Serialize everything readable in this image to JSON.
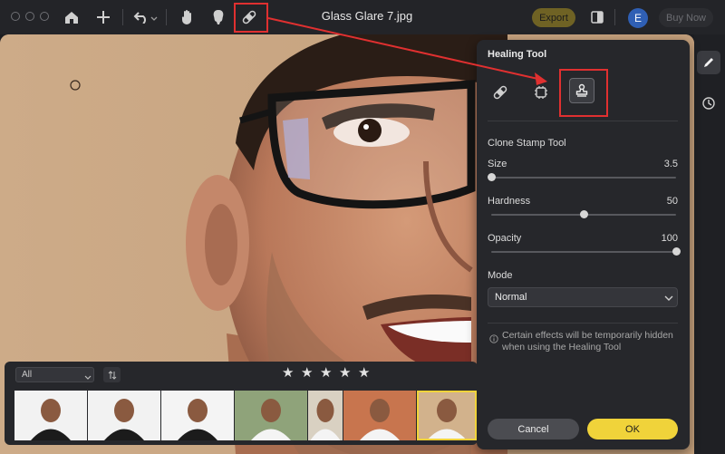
{
  "window": {
    "title": "Glass Glare 7.jpg",
    "export_label": "Export",
    "avatar_letter": "E",
    "buy_now_label": "Buy Now"
  },
  "toolbar": {
    "icons": [
      "home-icon",
      "plus-icon",
      "undo-icon",
      "chevron-down-icon",
      "hand-icon",
      "mask-icon",
      "bandage-icon",
      "compare-icon"
    ]
  },
  "healing_panel": {
    "title": "Healing Tool",
    "tools": [
      "bandage-icon",
      "chip-icon",
      "stamp-icon"
    ],
    "selected_tool": "stamp-icon",
    "section_title": "Clone Stamp Tool",
    "sliders": [
      {
        "label": "Size",
        "value": "3.5",
        "fraction": 0.0
      },
      {
        "label": "Hardness",
        "value": "50",
        "fraction": 0.5
      },
      {
        "label": "Opacity",
        "value": "100",
        "fraction": 1.0
      }
    ],
    "mode_label": "Mode",
    "mode_value": "Normal",
    "info_text": "Certain effects will be temporarily hidden when using the Healing Tool",
    "cancel_label": "Cancel",
    "ok_label": "OK"
  },
  "filmstrip": {
    "filter_value": "All",
    "rating_stars": 5,
    "thumbnails": [
      {
        "bg": "#f2f2f2",
        "selected": false
      },
      {
        "bg": "#f2f2f2",
        "selected": false
      },
      {
        "bg": "#f4f4f4",
        "selected": false
      },
      {
        "bg": "#8fa37a",
        "selected": false
      },
      {
        "bg": "#d9d1c2",
        "selected": false
      },
      {
        "bg": "#c8754e",
        "selected": false
      },
      {
        "bg": "#d2b28c",
        "selected": true
      }
    ]
  },
  "right_rail": {
    "icons": [
      "pencil-icon",
      "history-icon"
    ]
  },
  "colors": {
    "accent_yellow": "#f0d33a",
    "highlight_red": "#e03030",
    "canvas_bg": "#c9a785"
  }
}
